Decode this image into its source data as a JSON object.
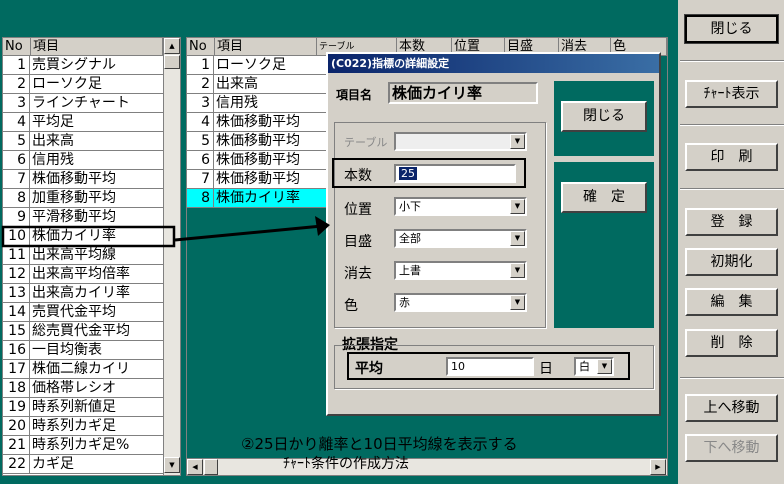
{
  "left_list": {
    "col_no": "No",
    "col_item": "項目",
    "items": [
      {
        "n": "1",
        "t": "売買シグナル"
      },
      {
        "n": "2",
        "t": "ローソク足"
      },
      {
        "n": "3",
        "t": "ラインチャート"
      },
      {
        "n": "4",
        "t": "平均足"
      },
      {
        "n": "5",
        "t": "出来高"
      },
      {
        "n": "6",
        "t": "信用残"
      },
      {
        "n": "7",
        "t": "株価移動平均"
      },
      {
        "n": "8",
        "t": "加重移動平均"
      },
      {
        "n": "9",
        "t": "平滑移動平均"
      },
      {
        "n": "10",
        "t": "株価カイリ率"
      },
      {
        "n": "11",
        "t": "出来高平均線"
      },
      {
        "n": "12",
        "t": "出来高平均倍率"
      },
      {
        "n": "13",
        "t": "出来高カイリ率"
      },
      {
        "n": "14",
        "t": "売買代金平均"
      },
      {
        "n": "15",
        "t": "総売買代金平均"
      },
      {
        "n": "16",
        "t": "一目均衡表"
      },
      {
        "n": "17",
        "t": "株価二線カイリ"
      },
      {
        "n": "18",
        "t": "価格帯レシオ"
      },
      {
        "n": "19",
        "t": "時系列新値足"
      },
      {
        "n": "20",
        "t": "時系列カギ足"
      },
      {
        "n": "21",
        "t": "時系列カギ足%"
      },
      {
        "n": "22",
        "t": "カギ足"
      }
    ]
  },
  "right_list": {
    "headers": [
      "No",
      "項目",
      "テーブル",
      "本数",
      "位置",
      "目盛",
      "消去",
      "色"
    ],
    "items": [
      {
        "n": "1",
        "t": "ローソク足"
      },
      {
        "n": "2",
        "t": "出来高"
      },
      {
        "n": "3",
        "t": "信用残"
      },
      {
        "n": "4",
        "t": "株価移動平均"
      },
      {
        "n": "5",
        "t": "株価移動平均"
      },
      {
        "n": "6",
        "t": "株価移動平均"
      },
      {
        "n": "7",
        "t": "株価移動平均"
      },
      {
        "n": "8",
        "t": "株価カイリ率"
      }
    ]
  },
  "dialog": {
    "title": "(C022)指標の詳細設定",
    "item_label": "項目名",
    "item_value": "株価カイリ率",
    "table_label": "テーブル",
    "count_label": "本数",
    "count_value": "25",
    "position_label": "位置",
    "position_value": "小下",
    "scale_label": "目盛",
    "scale_value": "全部",
    "erase_label": "消去",
    "erase_value": "上書",
    "color_label": "色",
    "color_value": "赤",
    "close_label": "閉じる",
    "confirm_label": "確　定",
    "ext_label": "拡張指定",
    "avg_label": "平均",
    "avg_value": "10",
    "day_label": "日",
    "avg_color": "白"
  },
  "buttons": {
    "close": "閉じる",
    "chart": "ﾁｬｰﾄ表示",
    "print": "印　刷",
    "register": "登　録",
    "init": "初期化",
    "edit": "編　集",
    "delete": "削　除",
    "up": "上へ移動",
    "down": "下へ移動"
  },
  "caption": {
    "line1": "②25日かり離率と10日平均線を表示する",
    "line2": "ﾁｬｰﾄ条件の作成方法"
  },
  "colors": {
    "teal": "#006a60",
    "highlight": "#00ffff",
    "title": "#0a246a"
  }
}
